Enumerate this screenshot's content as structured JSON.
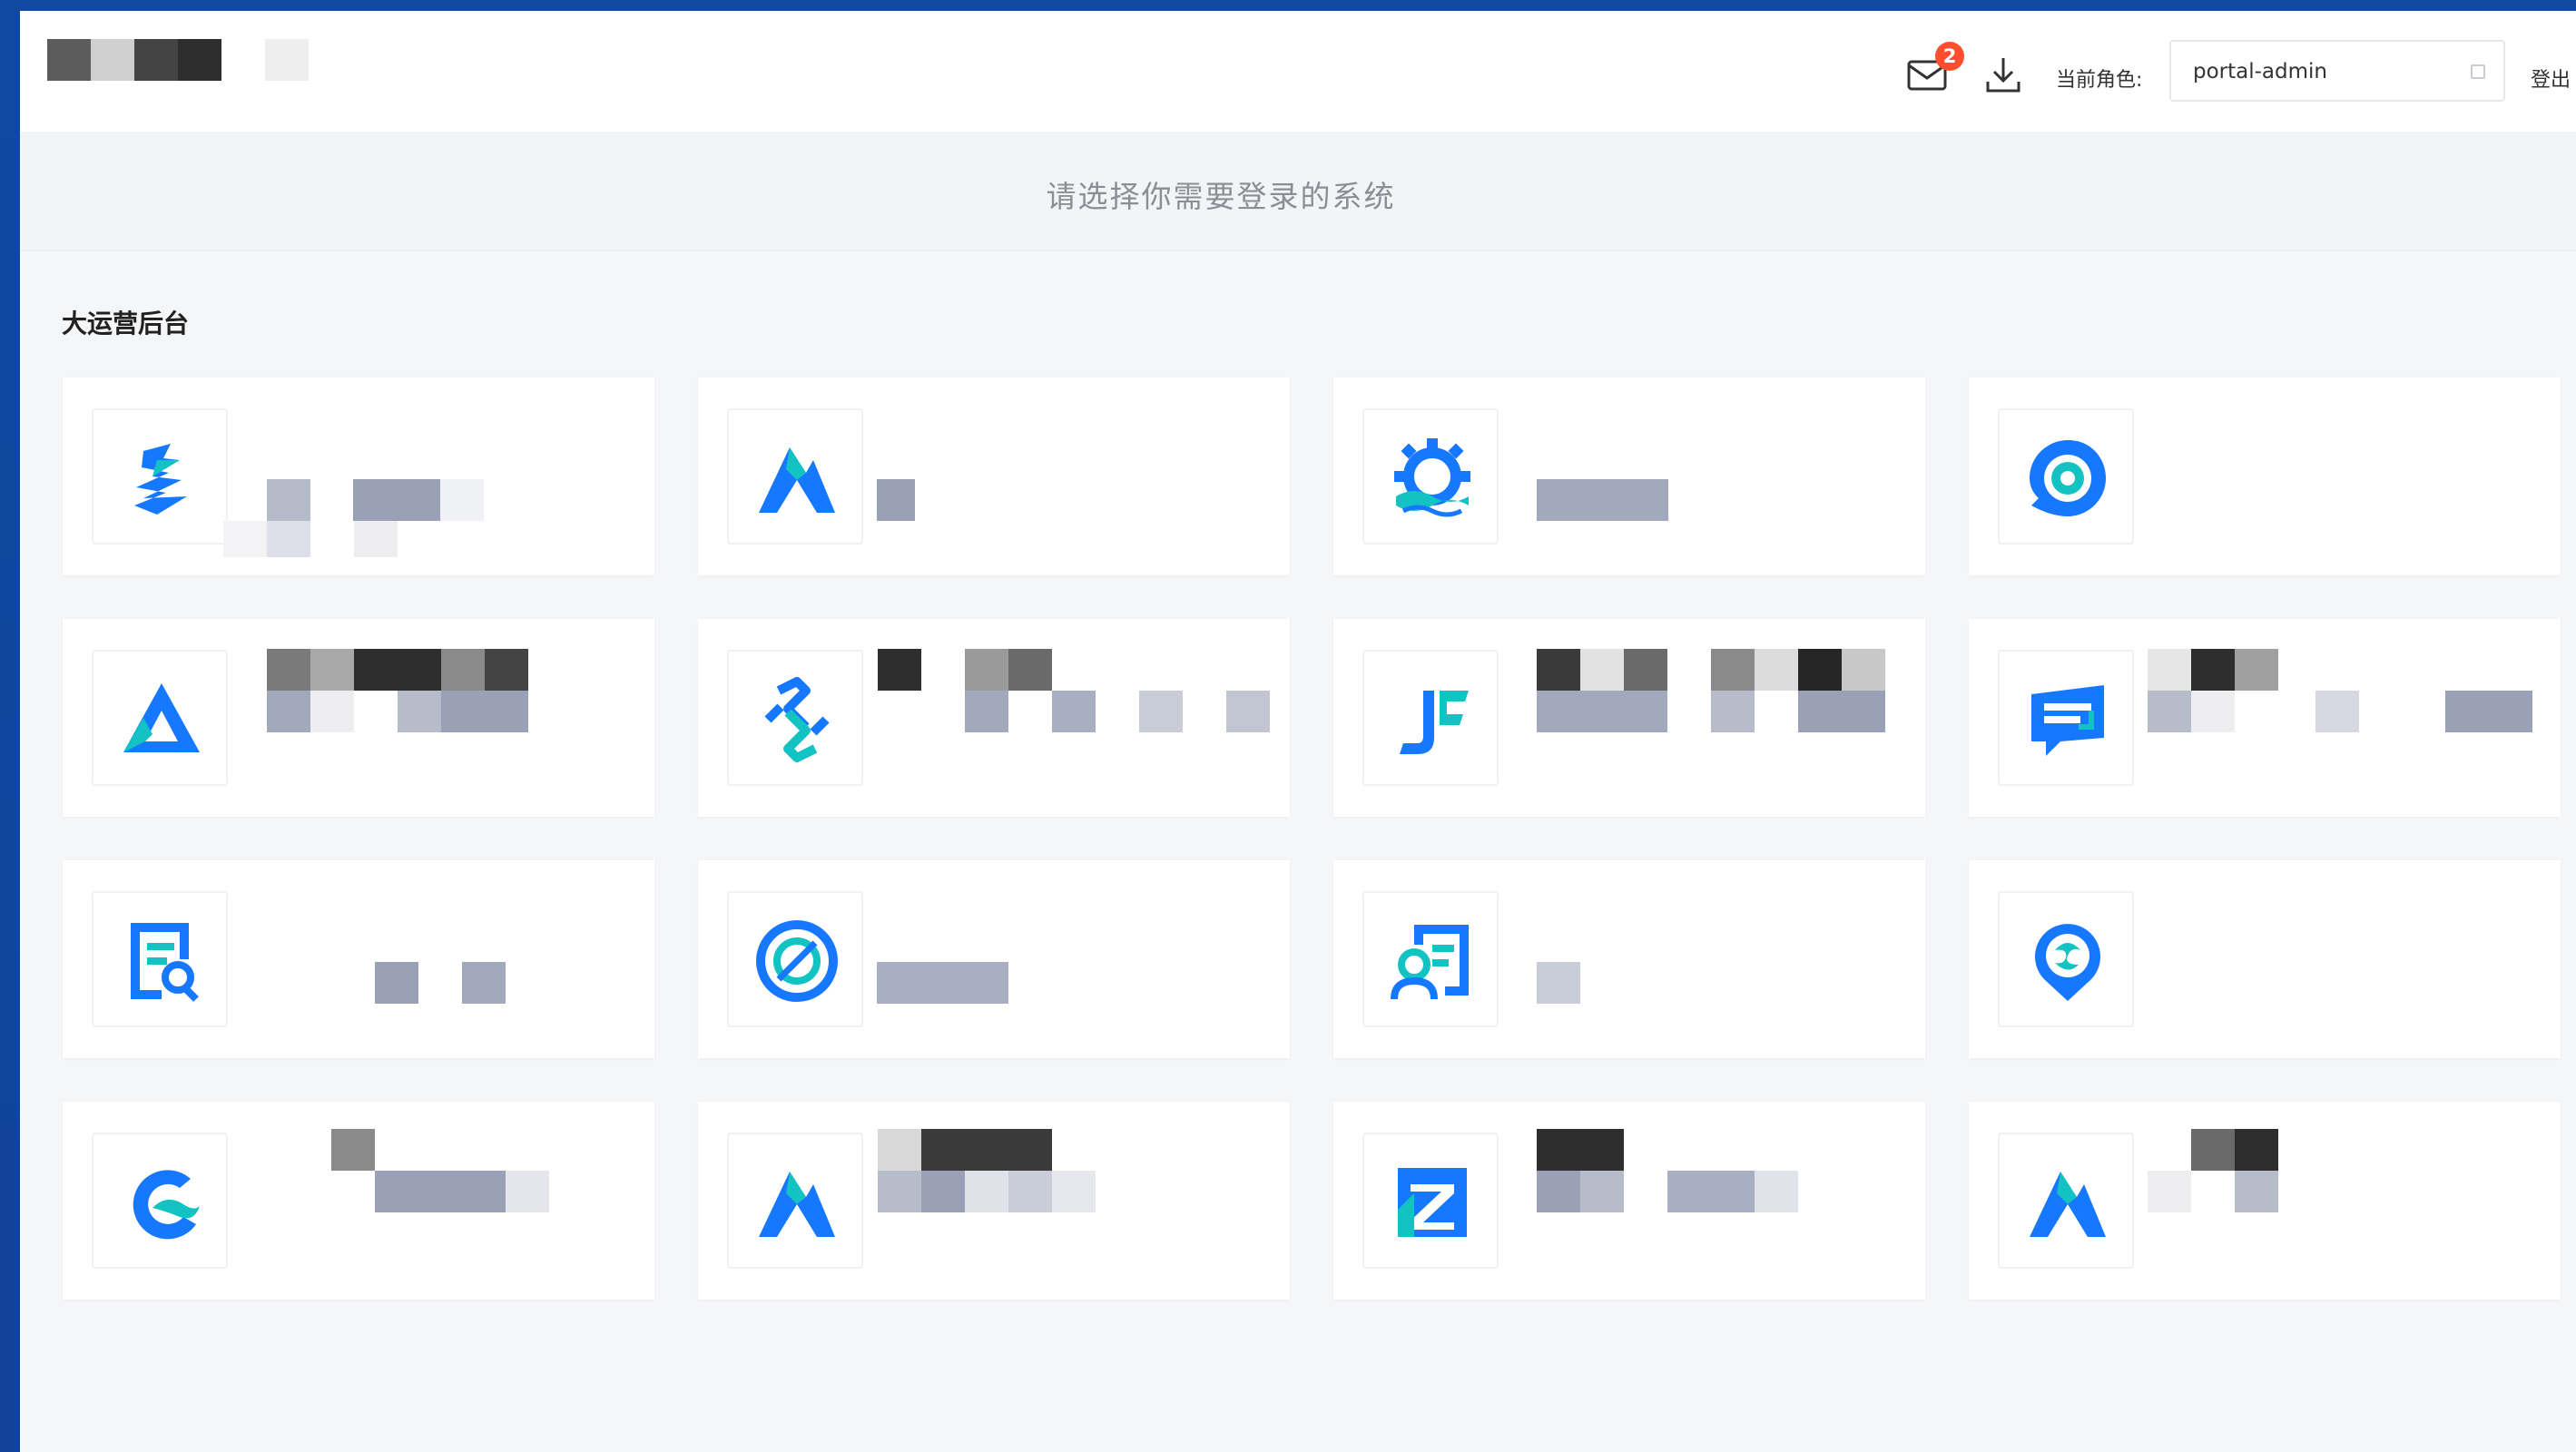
{
  "header": {
    "notification_count": "2",
    "role_label": "当前角色:",
    "role_value": "portal-admin",
    "logout_label": "登出"
  },
  "subtitle": "请选择你需要登录的系统",
  "section_title": "大运营后台",
  "colors": {
    "page_border": "#0f4aa0",
    "icon_blue": "#1677ff",
    "icon_teal": "#13c2c2",
    "badge": "#ff4d2e"
  },
  "cards": [
    {
      "icon": "dragon-icon"
    },
    {
      "icon": "mountain-icon"
    },
    {
      "icon": "gear-wave-icon"
    },
    {
      "icon": "eye-target-icon"
    },
    {
      "icon": "triangle-logo-icon"
    },
    {
      "icon": "puzzle-diamond-icon"
    },
    {
      "icon": "jf-logo-icon"
    },
    {
      "icon": "chat-message-icon"
    },
    {
      "icon": "document-search-icon"
    },
    {
      "icon": "circle-slash-icon"
    },
    {
      "icon": "user-card-icon"
    },
    {
      "icon": "location-swirl-icon"
    },
    {
      "icon": "wave-c-icon"
    },
    {
      "icon": "mountain-icon"
    },
    {
      "icon": "z-box-icon"
    },
    {
      "icon": "mountain-icon"
    }
  ]
}
